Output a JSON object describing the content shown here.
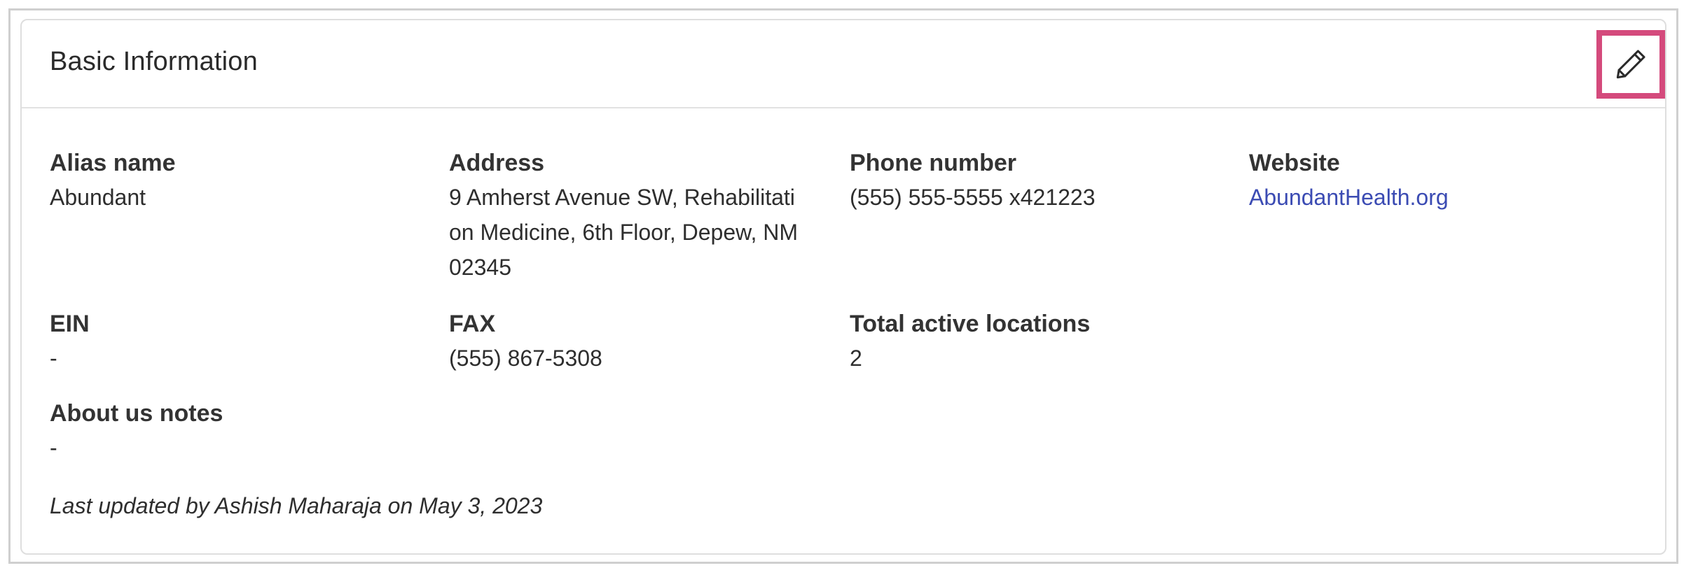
{
  "card": {
    "title": "Basic Information"
  },
  "fields": {
    "alias": {
      "label": "Alias name",
      "value": "Abundant"
    },
    "address": {
      "label": "Address",
      "lines": [
        "9 Amherst Avenue SW, Rehabilitati",
        "on Medicine, 6th Floor, Depew, NM",
        "02345"
      ]
    },
    "phone": {
      "label": "Phone number",
      "value": "(555) 555-5555 x421223"
    },
    "website": {
      "label": "Website",
      "value": "AbundantHealth.org"
    },
    "ein": {
      "label": "EIN",
      "value": "-"
    },
    "fax": {
      "label": "FAX",
      "value": "(555) 867-5308"
    },
    "locations": {
      "label": "Total active locations",
      "value": "2"
    },
    "about": {
      "label": "About us notes",
      "value": "-"
    }
  },
  "footer": {
    "last_updated": "Last updated by Ashish Maharaja on May 3, 2023"
  },
  "colors": {
    "accent_highlight": "#d44a7c",
    "link": "#3b4bb3"
  },
  "icons": {
    "edit": "pencil-icon"
  }
}
